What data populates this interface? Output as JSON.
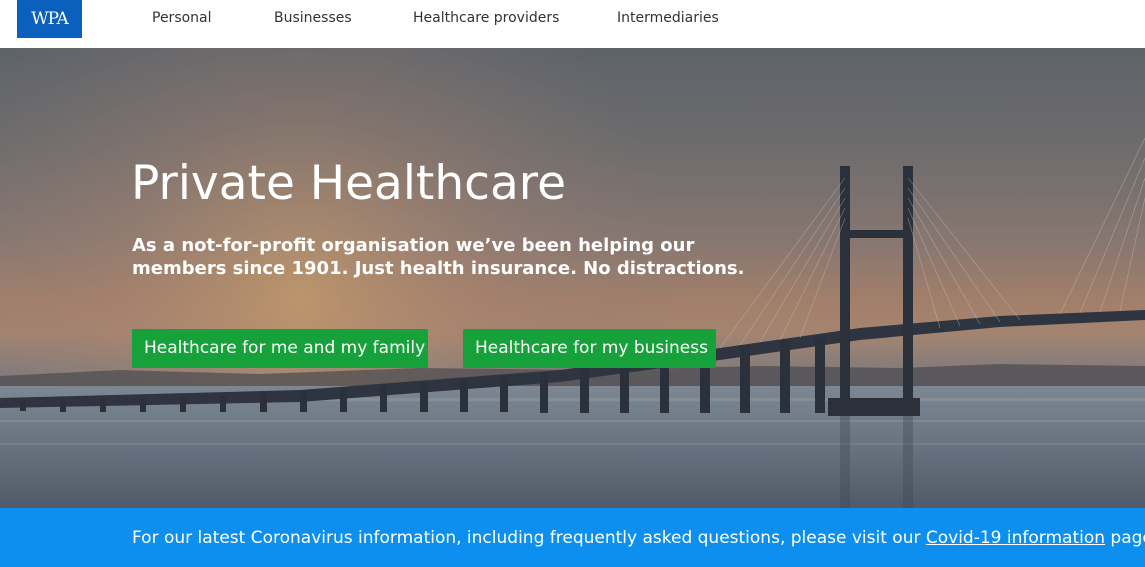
{
  "header": {
    "logo_text": "WPA",
    "nav": [
      "Personal",
      "Businesses",
      "Healthcare providers",
      "Intermediaries"
    ]
  },
  "hero": {
    "title": "Private Healthcare",
    "subtitle": "As a not-for-profit organisation we’ve been helping our members since 1901. Just health insurance. No distractions.",
    "buttons": {
      "family": "Healthcare for me and my family",
      "business": "Healthcare for my business"
    }
  },
  "banner": {
    "text_before": "For our latest Coronavirus information, including frequently asked questions, please visit our ",
    "link_text": "Covid-19 information",
    "text_after": " page."
  },
  "colors": {
    "brand_blue": "#0b5fbd",
    "cta_green": "#16a13a",
    "banner_blue": "#0d8ff0"
  },
  "icons": [
    "wpa-logo"
  ]
}
